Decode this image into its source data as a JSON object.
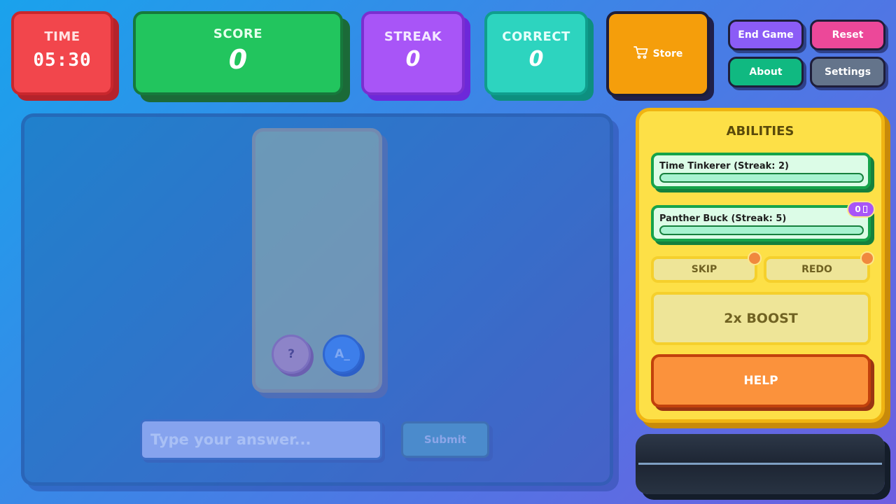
{
  "hud": {
    "time": {
      "label": "TIME",
      "value": "05:30"
    },
    "score": {
      "label": "SCORE",
      "value": "0"
    },
    "streak": {
      "label": "STREAK",
      "value": "0"
    },
    "correct": {
      "label": "CORRECT",
      "value": "0"
    }
  },
  "toolbar": {
    "store_label": "Store",
    "end_game_label": "End Game",
    "reset_label": "Reset",
    "about_label": "About",
    "settings_label": "Settings"
  },
  "board": {
    "hint_button": "?",
    "letter_button": "A_",
    "answer_placeholder": "Type your answer...",
    "submit_label": "Submit"
  },
  "abilities": {
    "title": "ABILITIES",
    "items": [
      {
        "name": "Time Tinkerer (Streak: 2)",
        "progress": 0
      },
      {
        "name": "Panther Buck (Streak: 5)",
        "progress": 0,
        "badge": "0"
      }
    ],
    "skip_label": "SKIP",
    "redo_label": "REDO",
    "boost_label": "2x BOOST",
    "help_label": "HELP"
  },
  "colors": {
    "time": "#f2464c",
    "score": "#22c55e",
    "streak": "#a855f7",
    "correct": "#2dd4bf",
    "store": "#f59e0b",
    "abilities_panel": "#fde047",
    "help": "#fb923c"
  },
  "icons": {
    "store": "cart-icon"
  }
}
